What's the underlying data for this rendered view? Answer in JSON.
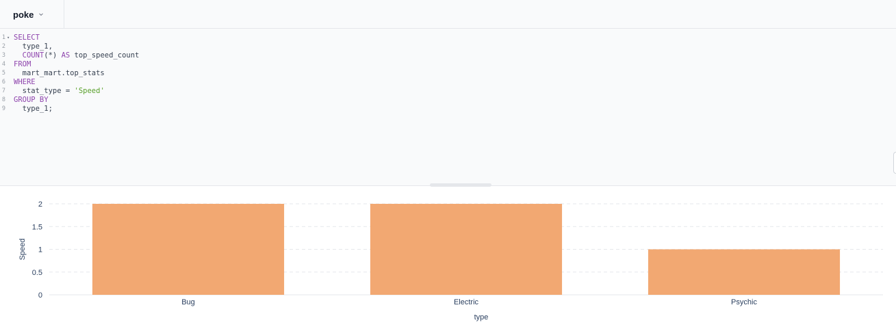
{
  "header": {
    "database": "poke"
  },
  "editor": {
    "lines": [
      {
        "num": "1",
        "fold": true,
        "tokens": [
          {
            "t": "SELECT",
            "k": "kw"
          }
        ]
      },
      {
        "num": "2",
        "fold": false,
        "tokens": [
          {
            "t": "  type_1,",
            "k": ""
          }
        ]
      },
      {
        "num": "3",
        "fold": false,
        "tokens": [
          {
            "t": "  COUNT",
            "k": "kw"
          },
          {
            "t": "(*) ",
            "k": ""
          },
          {
            "t": "AS",
            "k": "kw"
          },
          {
            "t": " top_speed_count",
            "k": ""
          }
        ]
      },
      {
        "num": "4",
        "fold": false,
        "tokens": [
          {
            "t": "FROM",
            "k": "kw"
          }
        ]
      },
      {
        "num": "5",
        "fold": false,
        "tokens": [
          {
            "t": "  mart_mart.top_stats",
            "k": ""
          }
        ]
      },
      {
        "num": "6",
        "fold": false,
        "tokens": [
          {
            "t": "WHERE",
            "k": "kw"
          }
        ]
      },
      {
        "num": "7",
        "fold": false,
        "tokens": [
          {
            "t": "  stat_type = ",
            "k": ""
          },
          {
            "t": "'Speed'",
            "k": "str"
          }
        ]
      },
      {
        "num": "8",
        "fold": false,
        "tokens": [
          {
            "t": "GROUP BY",
            "k": "kw"
          }
        ]
      },
      {
        "num": "9",
        "fold": false,
        "tokens": [
          {
            "t": "  type_1;",
            "k": ""
          }
        ]
      }
    ]
  },
  "colors": {
    "bar": "#f2a872",
    "grid": "#e5e7eb",
    "keyword": "#8e44ad",
    "string": "#5aa02c"
  },
  "icons": {
    "db_dropdown": "chevron-down-icon",
    "fold": "fold-arrow-icon"
  },
  "chart_data": {
    "type": "bar",
    "categories": [
      "Bug",
      "Electric",
      "Psychic"
    ],
    "values": [
      2,
      2,
      1
    ],
    "xlabel": "type",
    "ylabel": "Speed",
    "ylim": [
      0,
      2
    ],
    "yticks": [
      "0",
      "0.5",
      "1",
      "1.5",
      "2"
    ],
    "grid": true
  }
}
